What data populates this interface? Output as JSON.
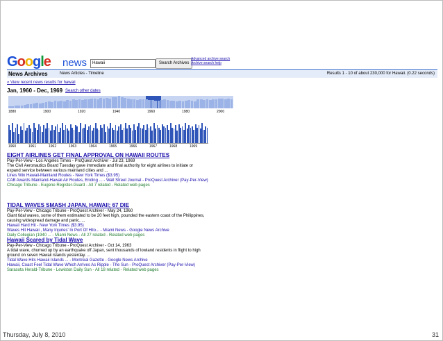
{
  "footer": {
    "date": "Thursday, July 8, 2010",
    "page": "31"
  },
  "header": {
    "logo": "Google",
    "logo_sub": "news",
    "search_value": "Hawaii",
    "search_button": "Search Archives",
    "adv1": "Advanced archive search",
    "adv2": "Archive search help"
  },
  "bar": {
    "title": "News Archives",
    "tabs": "News Articles - Timeline",
    "results": "Results 1 - 10 of about 230,000 for Hawaii. (0.22 seconds)"
  },
  "recent_link": "« View recent news results for hawaii",
  "range": "Jan, 1960 - Dec, 1969",
  "other_dates": "Search other dates",
  "timeline1": {
    "ticks": [
      "1880",
      "1900",
      "1920",
      "1940",
      "1960",
      "1980",
      "2000"
    ],
    "values": [
      0.15,
      0.18,
      0.2,
      0.25,
      0.22,
      0.3,
      0.35,
      0.32,
      0.4,
      0.45,
      0.38,
      0.42,
      0.5,
      0.55,
      0.48,
      0.6,
      0.58,
      0.62,
      0.55,
      0.65,
      0.6,
      0.7,
      0.68,
      0.72,
      0.66,
      0.75,
      0.7,
      0.78,
      0.8,
      0.74,
      0.82,
      0.76,
      0.85,
      0.8,
      0.88,
      0.9,
      1.0,
      0.9,
      0.85,
      0.8,
      0.72,
      0.7,
      0.68,
      0.74,
      0.7,
      0.72,
      0.65,
      0.68,
      0.62,
      0.6,
      0.66,
      0.7,
      0.64,
      0.62,
      0.6,
      0.58,
      0.62,
      0.55,
      0.6,
      0.66,
      0.62,
      0.58,
      0.7,
      0.74,
      0.68,
      0.72,
      0.66,
      0.7,
      0.74,
      0.8,
      0.76,
      0.72,
      0.78,
      0.74
    ]
  },
  "timeline2": {
    "ticks": [
      "1960",
      "1961",
      "1962",
      "1963",
      "1964",
      "1965",
      "1966",
      "1967",
      "1968",
      "1969"
    ],
    "values": [
      0.8,
      0.6,
      0.9,
      0.5,
      0.7,
      0.85,
      0.4,
      0.75,
      0.6,
      0.9,
      0.55,
      0.7,
      0.8,
      0.65,
      0.5,
      0.9,
      0.7,
      0.6,
      0.85,
      0.75,
      0.5,
      0.8,
      0.65,
      0.9,
      0.7,
      0.55,
      0.8,
      0.6,
      0.75,
      0.85,
      0.5,
      0.7,
      0.9,
      0.6,
      0.8,
      0.65,
      0.55,
      0.85,
      0.7,
      0.6,
      0.8,
      0.75,
      0.5,
      0.9,
      0.65,
      0.7,
      0.85,
      0.6,
      0.75,
      0.8,
      0.55,
      0.7,
      0.9,
      0.65,
      0.6,
      0.8,
      0.7,
      0.85,
      0.5,
      0.75,
      0.65,
      0.9,
      0.7,
      0.6,
      0.8,
      0.55,
      0.75,
      0.85,
      0.6,
      0.7,
      0.9,
      0.65,
      0.8,
      0.7,
      0.55,
      0.85,
      0.6,
      0.75,
      0.9,
      0.7,
      0.65,
      0.8,
      0.6,
      0.85,
      0.7,
      0.75,
      0.55,
      0.9,
      0.65,
      0.8,
      0.7,
      0.6,
      0.85,
      0.75,
      0.7,
      0.8,
      0.6,
      0.9,
      0.7,
      0.65,
      0.8,
      0.55,
      0.85,
      0.7,
      0.75,
      0.6,
      0.9,
      0.65,
      0.8,
      0.7,
      0.75,
      0.6,
      0.85,
      0.7,
      0.8,
      0.65,
      0.9,
      0.6,
      0.75,
      0.7
    ]
  },
  "results": [
    {
      "title": "EIGHT AIRLINES GET FINAL APPROVAL ON HAWAII ROUTES",
      "source": "Pay-Per-View - Los Angeles Times - ProQuest Archiver - Jul 23, 1969",
      "snippet1": "The Civil Aeronautics Board Tuesday gave immediate and final authority for eight airlines to initiate or",
      "snippet2": "expand service between various mainland cities and ...",
      "rel1": "Lines Win Hawaii-Mainland Routes - New York Times ($3.95)",
      "rel2": "CAB Awards Mainland-Hawaii Air Routes, Ending ... - Wall Street Journal - ProQuest Archiver (Pay-Per-View)",
      "footer": "Chicago Tribune - Eugene Register-Guard - All 7 related - Related web pages"
    },
    {
      "title": "TIDAL WAVES SMASH JAPAN, HAWAII; 67 DIE",
      "source": "Pay-Per-View - Chicago Tribune - ProQuest Archiver - May 24, 1960",
      "snippet1": "Giant tidal waves, some of them estimated to be 20 feet high, pounded the eastern coast of the Philippines,",
      "snippet2": "causing widespread damage and panic, ...",
      "rel1": "Hawaii Hard Hit - New York Times ($3.95)",
      "rel2": "Waves Hit Hawaii , Many Injuries' In Port Of Hilo... - Miami News - Google News Archive",
      "footer": "Daily Collegian (1940 ... - Miami News - All 27 related - Related web pages"
    },
    {
      "title": "Hawaii Scared by Tidal Wave",
      "source": "Pay-Per-View - Chicago Tribune - ProQuest Archiver - Oct 14, 1963",
      "snippet1": "A tidal wave, churned up by an earthquake off Japan, sent thousands of lowland residents in flight to high",
      "snippet2": "ground on seven Hawaii islands yesterday. ...",
      "rel1": "Tidal Wave Hits Hawaii Islands ... - Montreal Gazette - Google News Archive",
      "rel2": "Hawaii, Coast Feel Tidal Wave Which Arrives As Ripple - The Sun - ProQuest Archiver (Pay-Per-View)",
      "footer": "Sarasota Herald-Tribune - Lewiston Daily Sun - All 18 related - Related web pages"
    }
  ]
}
